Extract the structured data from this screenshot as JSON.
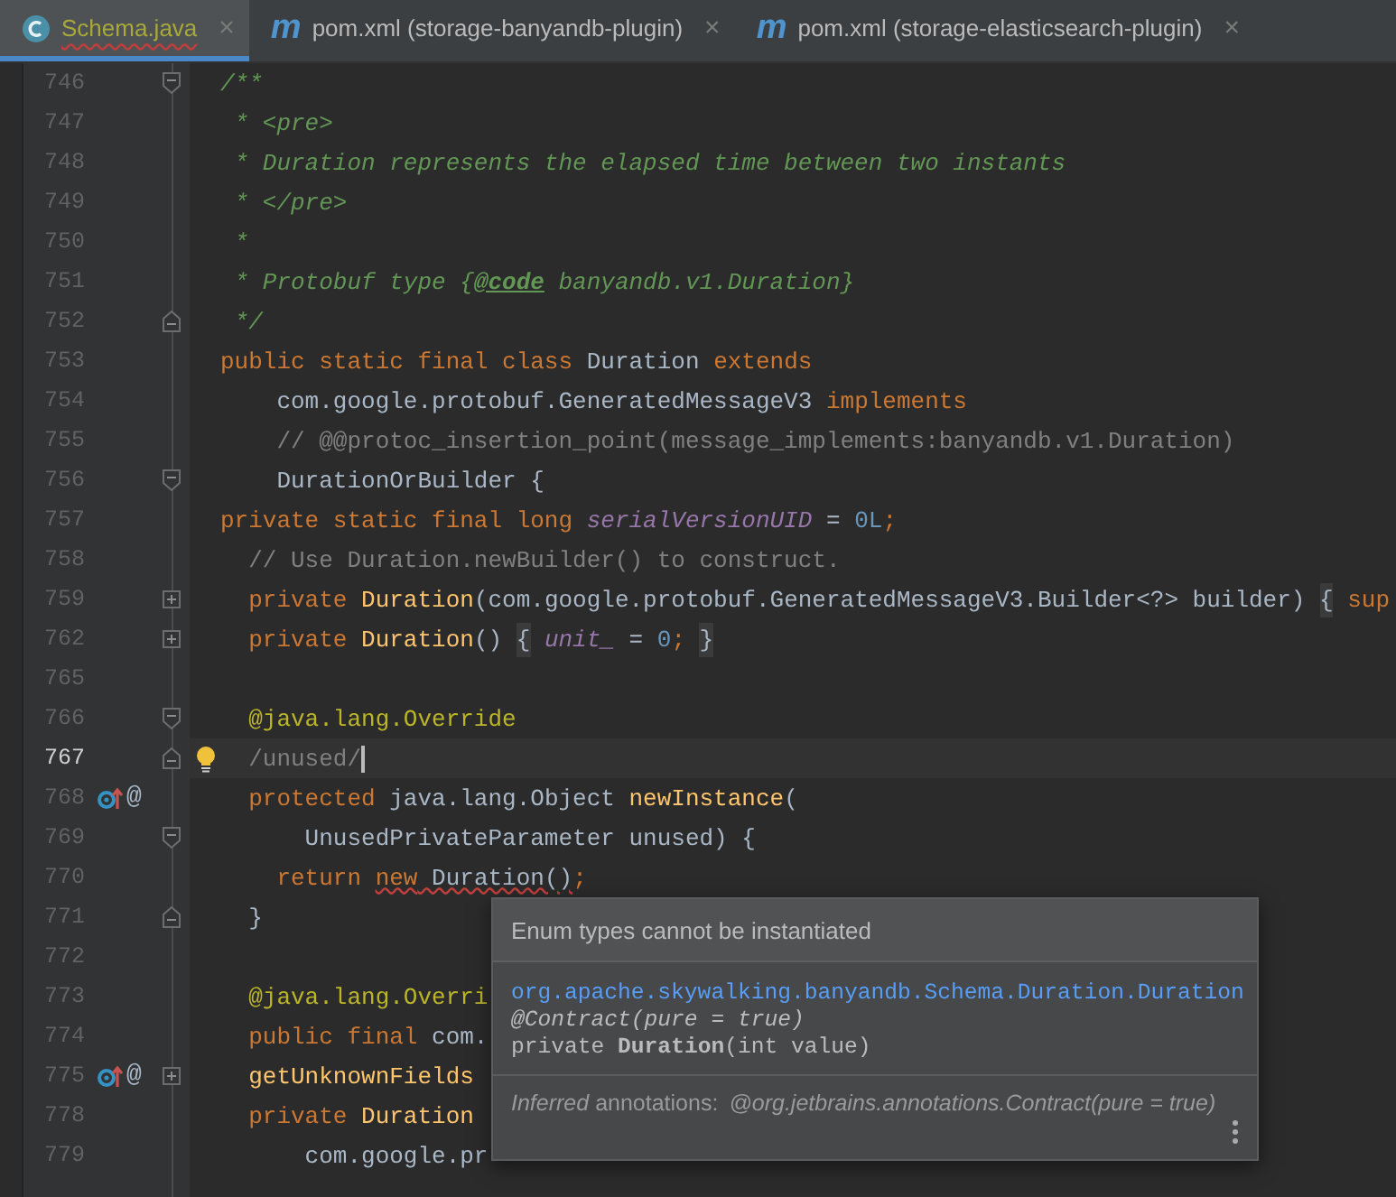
{
  "tabs": [
    {
      "kind": "class",
      "label": "Schema.java",
      "selected": true,
      "has_errors": true,
      "close": "×"
    },
    {
      "kind": "maven",
      "icon_glyph": "m",
      "label": "pom.xml (storage-banyandb-plugin)",
      "selected": false,
      "has_errors": false,
      "close": "×"
    },
    {
      "kind": "maven",
      "icon_glyph": "m",
      "label": "pom.xml (storage-elasticsearch-plugin)",
      "selected": false,
      "has_errors": false,
      "close": "×"
    }
  ],
  "lines": [
    {
      "number": "746",
      "current": false,
      "fold_marker": {
        "kind": "open"
      },
      "tokens": [
        {
          "kind": "doc",
          "text": "/**"
        }
      ]
    },
    {
      "number": "747",
      "current": false,
      "tokens": [
        {
          "kind": "doc",
          "text": " * <pre>"
        }
      ]
    },
    {
      "number": "748",
      "current": false,
      "tokens": [
        {
          "kind": "doc",
          "text": " * Duration represents the elapsed time between two instants"
        }
      ]
    },
    {
      "number": "749",
      "current": false,
      "tokens": [
        {
          "kind": "doc",
          "text": " * </pre>"
        }
      ]
    },
    {
      "number": "750",
      "current": false,
      "tokens": [
        {
          "kind": "doc",
          "text": " *"
        }
      ]
    },
    {
      "number": "751",
      "current": false,
      "tokens": [
        {
          "kind": "doc",
          "text": " * Protobuf type {"
        },
        {
          "kind": "doctag",
          "text": "@code"
        },
        {
          "kind": "doc",
          "text": " banyandb.v1.Duration}"
        }
      ]
    },
    {
      "number": "752",
      "current": false,
      "fold_marker": {
        "kind": "close"
      },
      "tokens": [
        {
          "kind": "doc",
          "text": " */"
        }
      ]
    },
    {
      "number": "753",
      "current": false,
      "tokens": [
        {
          "kind": "kw",
          "text": "public static final class "
        },
        {
          "kind": "plain",
          "text": "Duration "
        },
        {
          "kind": "kw",
          "text": "extends"
        }
      ]
    },
    {
      "number": "754",
      "current": false,
      "tokens": [
        {
          "kind": "plain",
          "text": "    com.google.protobuf.GeneratedMessageV3 "
        },
        {
          "kind": "kw",
          "text": "implements"
        }
      ]
    },
    {
      "number": "755",
      "current": false,
      "tokens": [
        {
          "kind": "comment",
          "text": "    // @@protoc_insertion_point(message_implements:banyandb.v1.Duration)"
        }
      ]
    },
    {
      "number": "756",
      "current": false,
      "fold_marker": {
        "kind": "open"
      },
      "tokens": [
        {
          "kind": "plain",
          "text": "    DurationOrBuilder {"
        }
      ]
    },
    {
      "number": "757",
      "current": false,
      "tokens": [
        {
          "kind": "kw",
          "text": "private static final long "
        },
        {
          "kind": "field",
          "text": "serialVersionUID"
        },
        {
          "kind": "plain",
          "text": " = "
        },
        {
          "kind": "num",
          "text": "0L"
        },
        {
          "kind": "kw",
          "text": ";"
        }
      ]
    },
    {
      "number": "758",
      "current": false,
      "tokens": [
        {
          "kind": "comment",
          "text": "  // Use Duration.newBuilder() to construct."
        }
      ]
    },
    {
      "number": "759",
      "current": false,
      "fold_marker": {
        "kind": "plus"
      },
      "tokens": [
        {
          "kind": "kw",
          "text": "  private "
        },
        {
          "kind": "method",
          "text": "Duration"
        },
        {
          "kind": "plain",
          "text": "(com.google.protobuf.GeneratedMessageV3.Builder<?> builder) "
        },
        {
          "kind": "folded",
          "text": "{"
        },
        {
          "kind": "kw",
          "text": " sup"
        }
      ]
    },
    {
      "number": "762",
      "current": false,
      "fold_marker": {
        "kind": "plus"
      },
      "tokens": [
        {
          "kind": "kw",
          "text": "  private "
        },
        {
          "kind": "method",
          "text": "Duration"
        },
        {
          "kind": "plain",
          "text": "() "
        },
        {
          "kind": "folded",
          "text": "{"
        },
        {
          "kind": "field",
          "text": " unit_"
        },
        {
          "kind": "plain",
          "text": " = "
        },
        {
          "kind": "num",
          "text": "0"
        },
        {
          "kind": "kw",
          "text": "; "
        },
        {
          "kind": "folded",
          "text": "}"
        }
      ]
    },
    {
      "number": "765",
      "current": false
    },
    {
      "number": "766",
      "current": false,
      "fold_marker": {
        "kind": "open"
      },
      "tokens": [
        {
          "kind": "ann",
          "text": "  @java.lang.Override"
        }
      ]
    },
    {
      "number": "767",
      "current": true,
      "fold_marker": {
        "kind": "close"
      },
      "intention": {
        "kind": "bulb"
      },
      "tokens": [
        {
          "kind": "indent_unused",
          "text": "  /unused/"
        }
      ]
    },
    {
      "number": "768",
      "current": false,
      "gutter_icons": [
        {
          "kind": "override"
        },
        {
          "kind": "annotation",
          "text": "@"
        }
      ],
      "tokens": [
        {
          "kind": "kw",
          "text": "  protected "
        },
        {
          "kind": "plain",
          "text": "java.lang.Object "
        },
        {
          "kind": "method",
          "text": "newInstance"
        },
        {
          "kind": "plain",
          "text": "("
        }
      ]
    },
    {
      "number": "769",
      "current": false,
      "fold_marker": {
        "kind": "open"
      },
      "tokens": [
        {
          "kind": "plain",
          "text": "      UnusedPrivateParameter unused) {"
        }
      ]
    },
    {
      "number": "770",
      "current": false,
      "tokens": [
        {
          "kind": "kw",
          "text": "    return "
        },
        {
          "kind": "kw_error",
          "text": "new"
        },
        {
          "kind": "plain_error",
          "text": " Duration()"
        },
        {
          "kind": "kw",
          "text": ";"
        }
      ]
    },
    {
      "number": "771",
      "current": false,
      "fold_marker": {
        "kind": "close"
      },
      "tokens": [
        {
          "kind": "plain",
          "text": "  }"
        }
      ]
    },
    {
      "number": "772",
      "current": false
    },
    {
      "number": "773",
      "current": false,
      "tokens": [
        {
          "kind": "ann",
          "text": "  @java.lang.Overri"
        }
      ]
    },
    {
      "number": "774",
      "current": false,
      "tokens": [
        {
          "kind": "kw",
          "text": "  public final "
        },
        {
          "kind": "plain",
          "text": "com."
        }
      ]
    },
    {
      "number": "775",
      "current": false,
      "fold_marker": {
        "kind": "plus"
      },
      "gutter_icons": [
        {
          "kind": "override"
        },
        {
          "kind": "annotation",
          "text": "@"
        }
      ],
      "tokens": [
        {
          "kind": "method",
          "text": "  getUnknownFields"
        }
      ]
    },
    {
      "number": "778",
      "current": false,
      "tokens": [
        {
          "kind": "kw",
          "text": "  private "
        },
        {
          "kind": "method",
          "text": "Duration"
        }
      ]
    },
    {
      "number": "779",
      "current": false,
      "tokens": [
        {
          "kind": "plain",
          "text": "      com.google.pr"
        }
      ]
    }
  ],
  "tooltip": {
    "title": "Enum types cannot be instantiated",
    "link": "org.apache.skywalking.banyandb.Schema.Duration.Duration",
    "annotation": "@Contract(pure = true)",
    "signature": "private **Duration**(int value)",
    "inferred_label": "*Inferred* annotations:",
    "inferred_value": "@org.jetbrains.annotations.Contract(pure = true)"
  }
}
